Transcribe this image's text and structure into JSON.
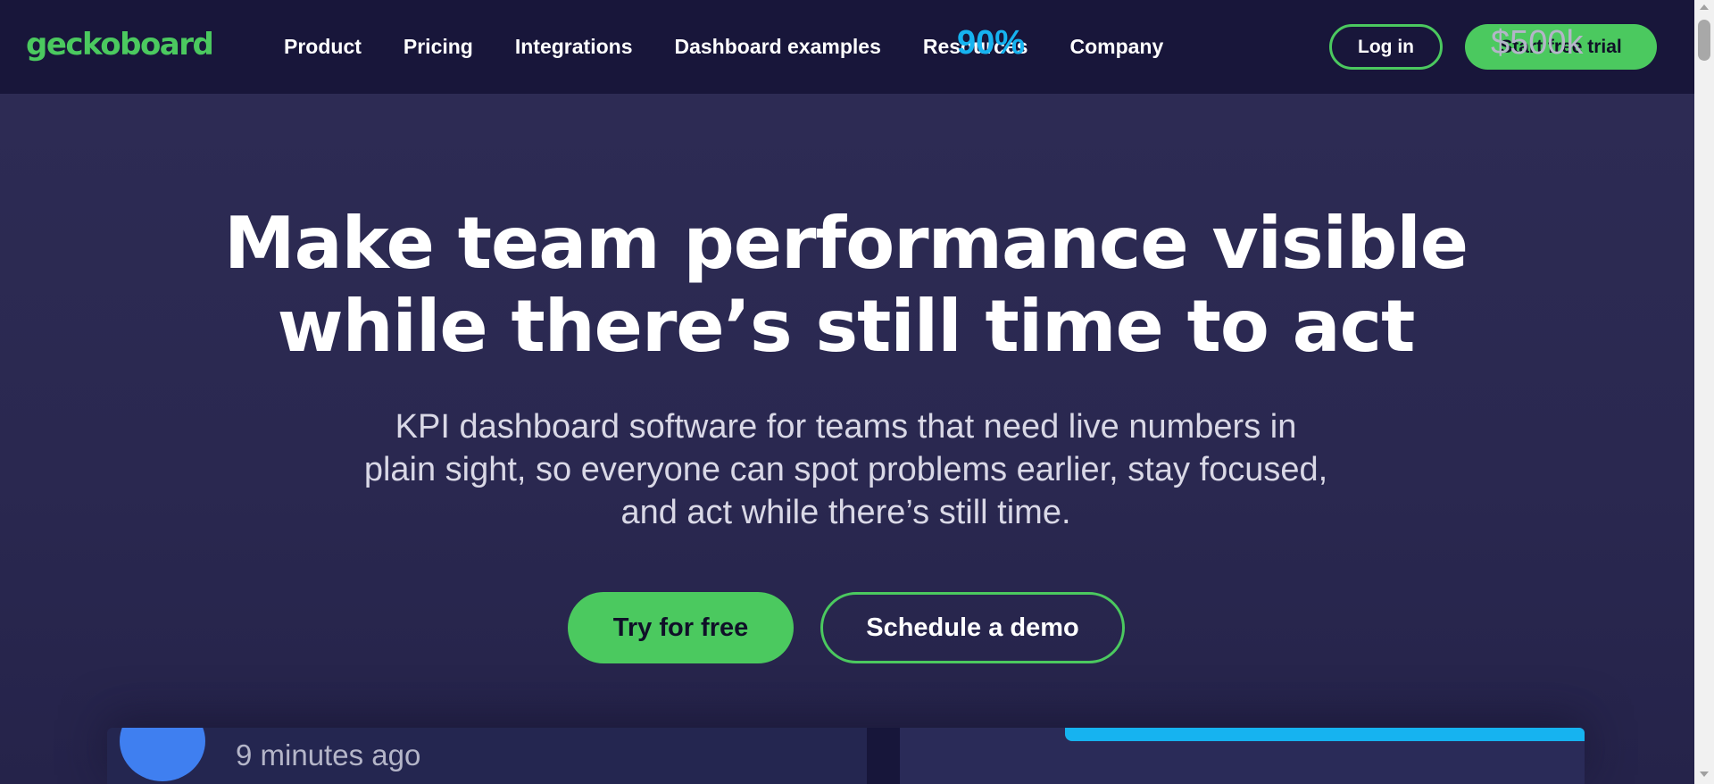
{
  "brand": {
    "logo_text": "geckoboard"
  },
  "nav": {
    "links": [
      "Product",
      "Pricing",
      "Integrations",
      "Dashboard examples",
      "Resources",
      "Company"
    ],
    "login_label": "Log in",
    "trial_label": "Start free trial"
  },
  "hero": {
    "title_line1": "Make team performance visible",
    "title_line2": "while there’s still time to act",
    "subtitle_line1": "KPI dashboard software for teams that need live numbers in",
    "subtitle_line2": "plain sight, so everyone can spot problems earlier, stay focused,",
    "subtitle_line3": "and act while there’s still time.",
    "try_label": "Try for free",
    "demo_label": "Schedule a demo"
  },
  "dashboard_preview": {
    "time_ago": "9 minutes ago",
    "progress_percent_label": "90%",
    "progress_value": 0.9,
    "amount": "$500k"
  },
  "colors": {
    "accent_green": "#4bc95f",
    "nav_bg": "#18163a",
    "page_bg": "#2a2850",
    "progress_blue": "#16b3f0",
    "avatar_blue": "#3f7ff0"
  }
}
